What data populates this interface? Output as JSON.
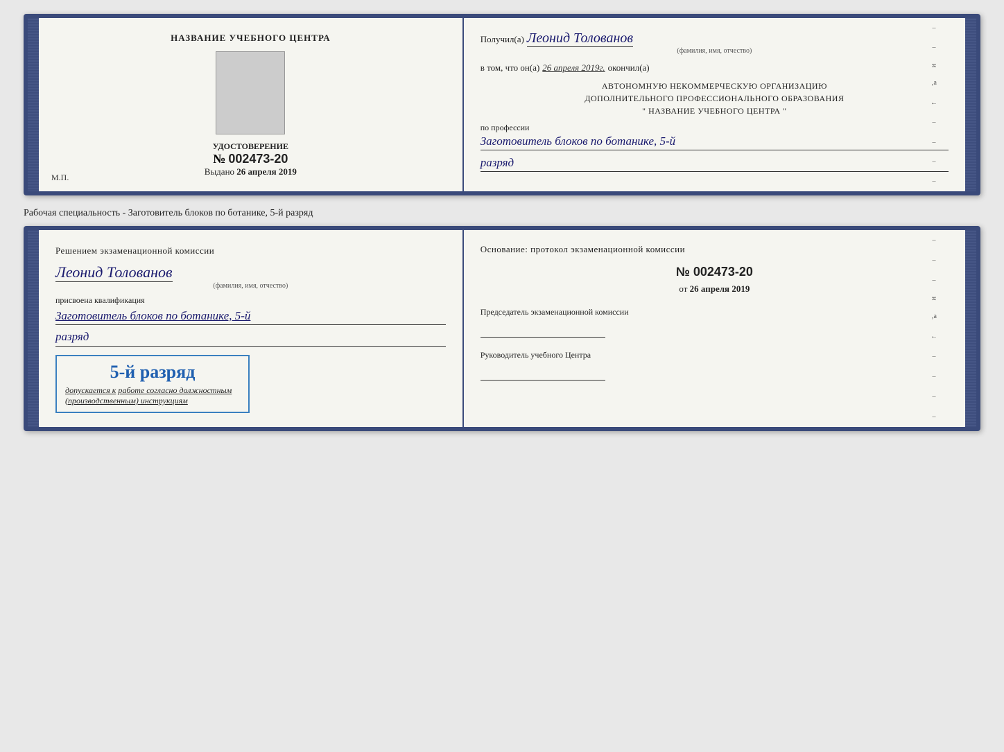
{
  "topCert": {
    "leftSide": {
      "centerTitle": "НАЗВАНИЕ УЧЕБНОГО ЦЕНТРА",
      "certLabel": "УДОСТОВЕРЕНИЕ",
      "certNumberPrefix": "№",
      "certNumber": "002473-20",
      "issuedLabel": "Выдано",
      "issuedDate": "26 апреля 2019"
    },
    "rightSide": {
      "recipientPrefix": "Получил(а)",
      "recipientName": "Леонид Толованов",
      "fioLabel": "(фамилия, имя, отчество)",
      "inThatLine": "в том, что он(а)",
      "completionDate": "26 апреля 2019г.",
      "finishedLabel": "окончил(а)",
      "orgLine1": "АВТОНОМНУЮ НЕКОММЕРЧЕСКУЮ ОРГАНИЗАЦИЮ",
      "orgLine2": "ДОПОЛНИТЕЛЬНОГО ПРОФЕССИОНАЛЬНОГО ОБРАЗОВАНИЯ",
      "orgLine3": "\"   НАЗВАНИЕ УЧЕБНОГО ЦЕНТРА   \"",
      "professionLabel": "по профессии",
      "professionValue": "Заготовитель блоков по ботанике, 5-й",
      "rankValue": "разряд"
    },
    "mpLabel": "М.П."
  },
  "subtitle": "Рабочая специальность - Заготовитель блоков по ботанике, 5-й разряд",
  "bottomCert": {
    "leftSide": {
      "decisionText": "Решением экзаменационной комиссии",
      "personName": "Леонид Толованов",
      "fioLabel": "(фамилия, имя, отчество)",
      "assignedLabel": "присвоена квалификация",
      "qualificationValue": "Заготовитель блоков по ботанике, 5-й",
      "rankValue": "разряд",
      "stampGrade": "5-й разряд",
      "admittedText": "допускается к",
      "admittedItalic": "работе согласно должностным (производственным) инструкциям"
    },
    "rightSide": {
      "basisLabel": "Основание: протокол экзаменационной комиссии",
      "protocolPrefix": "№",
      "protocolNumber": "002473-20",
      "fromPrefix": "от",
      "fromDate": "26 апреля 2019",
      "chairmanLabel": "Председатель экзаменационной комиссии",
      "directorLabel": "Руководитель учебного Центра"
    }
  }
}
